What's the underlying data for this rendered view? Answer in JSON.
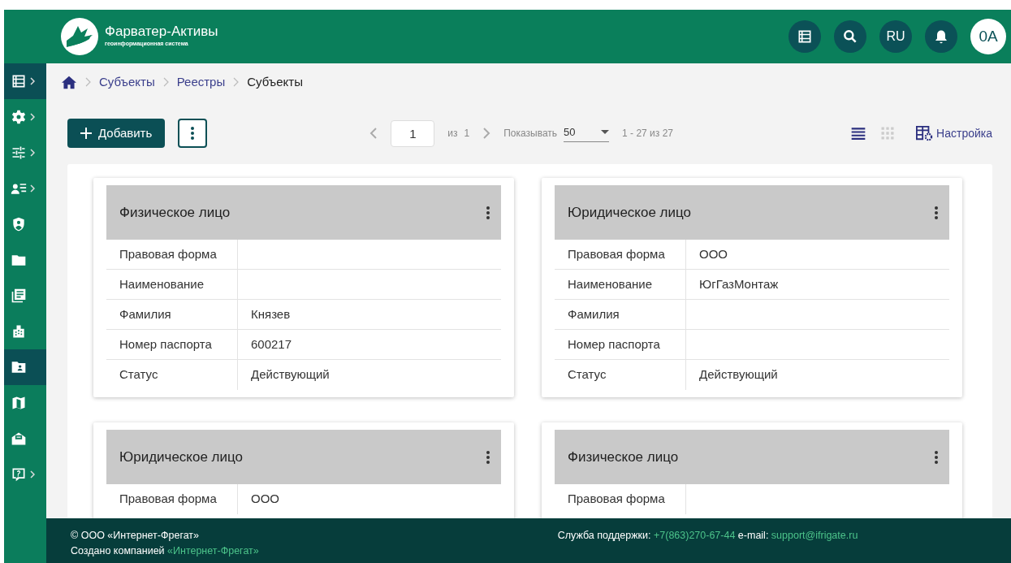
{
  "header": {
    "title": "Фарватер-Активы",
    "subtitle": "геоинформационная система",
    "buttons": [
      {
        "kind": "list"
      },
      {
        "kind": "search"
      },
      {
        "kind": "text",
        "label": "RU"
      },
      {
        "kind": "bell"
      },
      {
        "kind": "avatar",
        "label": "0A"
      }
    ]
  },
  "sidebar": {
    "items": [
      {
        "kind": "list",
        "selected": true,
        "submenu": true
      },
      {
        "kind": "gear",
        "selected": false,
        "submenu": true
      },
      {
        "kind": "sliders",
        "selected": false,
        "submenu": true
      },
      {
        "kind": "person-list",
        "selected": false,
        "submenu": true
      },
      {
        "kind": "shield",
        "selected": false,
        "submenu": false
      },
      {
        "kind": "folder",
        "selected": false,
        "submenu": false
      },
      {
        "kind": "docs",
        "selected": false,
        "submenu": false
      },
      {
        "kind": "building",
        "selected": false,
        "submenu": false
      },
      {
        "kind": "folder-person",
        "selected": true,
        "submenu": false
      },
      {
        "kind": "map",
        "selected": false,
        "submenu": false
      },
      {
        "kind": "mail",
        "selected": false,
        "submenu": false
      },
      {
        "kind": "help",
        "selected": false,
        "submenu": true
      }
    ]
  },
  "breadcrumbs": [
    {
      "label": "Субъекты",
      "current": false
    },
    {
      "label": "Реестры",
      "current": false
    },
    {
      "label": "Субъекты",
      "current": true
    }
  ],
  "toolbar": {
    "add_label": "Добавить",
    "page": "1",
    "of_label": "из",
    "page_count": "1",
    "show_label": "Показывать",
    "page_size": "50",
    "range": "1 - 27 из 27",
    "view_modes": [
      {
        "kind": "list",
        "selected": true
      },
      {
        "kind": "grid",
        "selected": false
      }
    ],
    "settings_label": "Настройка"
  },
  "cards": [
    {
      "title": "Физическое лицо",
      "rows": [
        {
          "label": "Правовая форма"
        },
        {
          "label": "Наименование"
        },
        {
          "label": "Фамилия",
          "value": "Князев"
        },
        {
          "label": "Номер паспорта",
          "value": "600217"
        },
        {
          "label": "Статус",
          "value": "Действующий"
        }
      ]
    },
    {
      "title": "Юридическое лицо",
      "rows": [
        {
          "label": "Правовая форма",
          "value": "ООО"
        },
        {
          "label": "Наименование",
          "value": "ЮгГазМонтаж"
        },
        {
          "label": "Фамилия"
        },
        {
          "label": "Номер паспорта"
        },
        {
          "label": "Статус",
          "value": "Действующий"
        }
      ]
    },
    {
      "title": "Юридическое лицо",
      "rows": [
        {
          "label": "Правовая форма",
          "value": "ООО"
        }
      ]
    },
    {
      "title": "Физическое лицо",
      "rows": [
        {
          "label": "Правовая форма"
        }
      ]
    }
  ],
  "footer": {
    "copyright": "© ООО «Интернет-Фрегат»",
    "created_label": "Создано компанией",
    "created_link": "«Интернет-Фрегат»",
    "support_label": "Служба поддержки:",
    "phone": "+7(863)270-67-44",
    "email_label": "e-mail:",
    "email": "support@ifrigate.ru"
  }
}
